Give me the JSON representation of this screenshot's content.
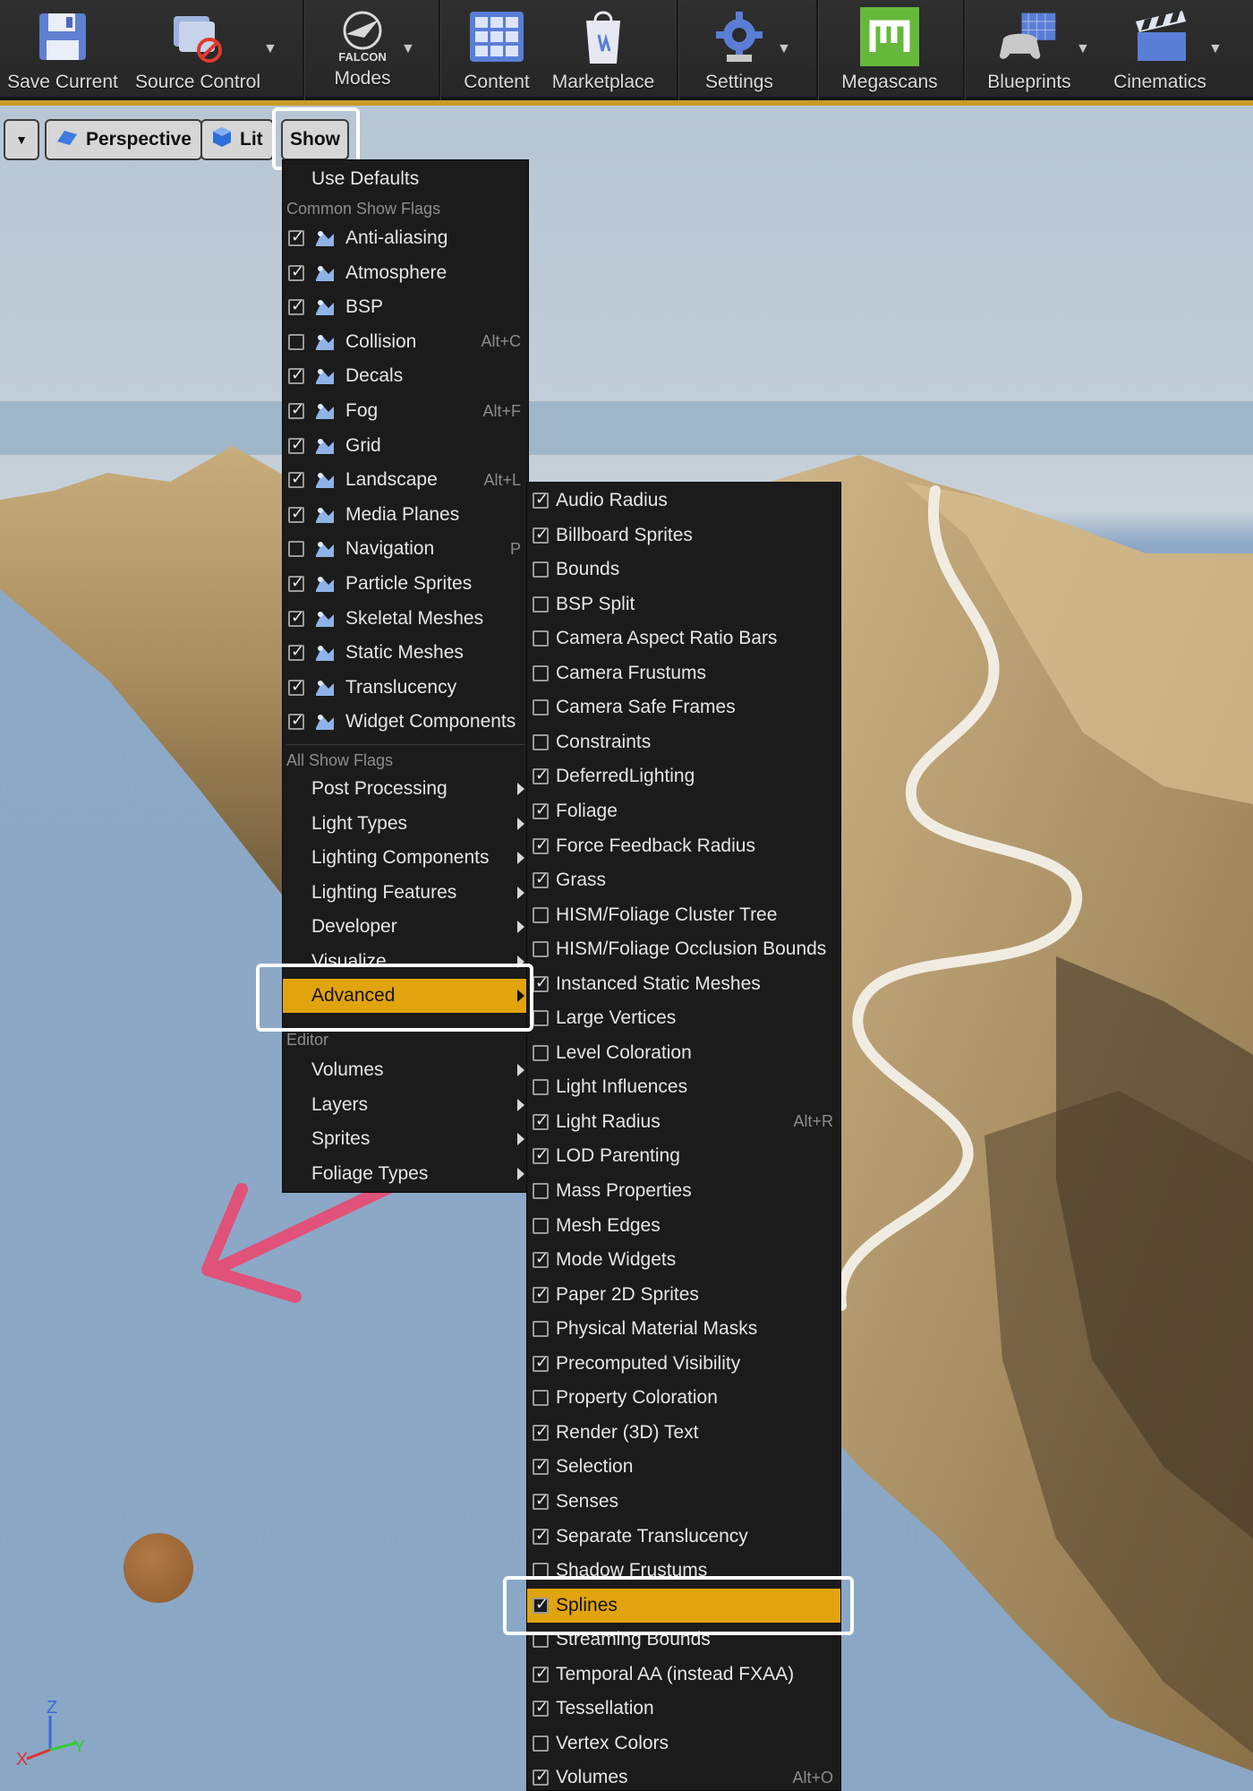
{
  "toolbar": {
    "save_current": "Save Current",
    "source_control": "Source Control",
    "modes_brand": "FALCON",
    "modes": "Modes",
    "content": "Content",
    "marketplace": "Marketplace",
    "settings": "Settings",
    "megascans": "Megascans",
    "blueprints": "Blueprints",
    "cinematics": "Cinematics"
  },
  "viewport": {
    "perspective": "Perspective",
    "lit": "Lit",
    "show": "Show"
  },
  "show_menu": {
    "use_defaults": "Use Defaults",
    "common_header": "Common Show Flags",
    "common": [
      {
        "label": "Anti-aliasing",
        "checked": true,
        "shortcut": ""
      },
      {
        "label": "Atmosphere",
        "checked": true,
        "shortcut": ""
      },
      {
        "label": "BSP",
        "checked": true,
        "shortcut": ""
      },
      {
        "label": "Collision",
        "checked": false,
        "shortcut": "Alt+C"
      },
      {
        "label": "Decals",
        "checked": true,
        "shortcut": ""
      },
      {
        "label": "Fog",
        "checked": true,
        "shortcut": "Alt+F"
      },
      {
        "label": "Grid",
        "checked": true,
        "shortcut": ""
      },
      {
        "label": "Landscape",
        "checked": true,
        "shortcut": "Alt+L"
      },
      {
        "label": "Media Planes",
        "checked": true,
        "shortcut": ""
      },
      {
        "label": "Navigation",
        "checked": false,
        "shortcut": "P"
      },
      {
        "label": "Particle Sprites",
        "checked": true,
        "shortcut": ""
      },
      {
        "label": "Skeletal Meshes",
        "checked": true,
        "shortcut": ""
      },
      {
        "label": "Static Meshes",
        "checked": true,
        "shortcut": ""
      },
      {
        "label": "Translucency",
        "checked": true,
        "shortcut": ""
      },
      {
        "label": "Widget Components",
        "checked": true,
        "shortcut": ""
      }
    ],
    "all_header": "All Show Flags",
    "all": [
      "Post Processing",
      "Light Types",
      "Lighting Components",
      "Lighting Features",
      "Developer",
      "Visualize",
      "Advanced"
    ],
    "editor_header": "Editor",
    "editor": [
      "Volumes",
      "Layers",
      "Sprites",
      "Foliage Types"
    ]
  },
  "advanced_menu": [
    {
      "label": "Audio Radius",
      "checked": true,
      "shortcut": ""
    },
    {
      "label": "Billboard Sprites",
      "checked": true,
      "shortcut": ""
    },
    {
      "label": "Bounds",
      "checked": false,
      "shortcut": ""
    },
    {
      "label": "BSP Split",
      "checked": false,
      "shortcut": ""
    },
    {
      "label": "Camera Aspect Ratio Bars",
      "checked": false,
      "shortcut": ""
    },
    {
      "label": "Camera Frustums",
      "checked": false,
      "shortcut": ""
    },
    {
      "label": "Camera Safe Frames",
      "checked": false,
      "shortcut": ""
    },
    {
      "label": "Constraints",
      "checked": false,
      "shortcut": ""
    },
    {
      "label": "DeferredLighting",
      "checked": true,
      "shortcut": ""
    },
    {
      "label": "Foliage",
      "checked": true,
      "shortcut": ""
    },
    {
      "label": "Force Feedback Radius",
      "checked": true,
      "shortcut": ""
    },
    {
      "label": "Grass",
      "checked": true,
      "shortcut": ""
    },
    {
      "label": "HISM/Foliage Cluster Tree",
      "checked": false,
      "shortcut": ""
    },
    {
      "label": "HISM/Foliage Occlusion Bounds",
      "checked": false,
      "shortcut": ""
    },
    {
      "label": "Instanced Static Meshes",
      "checked": true,
      "shortcut": ""
    },
    {
      "label": "Large Vertices",
      "checked": false,
      "shortcut": ""
    },
    {
      "label": "Level Coloration",
      "checked": false,
      "shortcut": ""
    },
    {
      "label": "Light Influences",
      "checked": false,
      "shortcut": ""
    },
    {
      "label": "Light Radius",
      "checked": true,
      "shortcut": "Alt+R"
    },
    {
      "label": "LOD Parenting",
      "checked": true,
      "shortcut": ""
    },
    {
      "label": "Mass Properties",
      "checked": false,
      "shortcut": ""
    },
    {
      "label": "Mesh Edges",
      "checked": false,
      "shortcut": ""
    },
    {
      "label": "Mode Widgets",
      "checked": true,
      "shortcut": ""
    },
    {
      "label": "Paper 2D Sprites",
      "checked": true,
      "shortcut": ""
    },
    {
      "label": "Physical Material Masks",
      "checked": false,
      "shortcut": ""
    },
    {
      "label": "Precomputed Visibility",
      "checked": true,
      "shortcut": ""
    },
    {
      "label": "Property Coloration",
      "checked": false,
      "shortcut": ""
    },
    {
      "label": "Render (3D) Text",
      "checked": true,
      "shortcut": ""
    },
    {
      "label": "Selection",
      "checked": true,
      "shortcut": ""
    },
    {
      "label": "Senses",
      "checked": true,
      "shortcut": ""
    },
    {
      "label": "Separate Translucency",
      "checked": true,
      "shortcut": ""
    },
    {
      "label": "Shadow Frustums",
      "checked": false,
      "shortcut": ""
    },
    {
      "label": "Splines",
      "checked": true,
      "shortcut": ""
    },
    {
      "label": "Streaming Bounds",
      "checked": false,
      "shortcut": ""
    },
    {
      "label": "Temporal AA (instead FXAA)",
      "checked": true,
      "shortcut": ""
    },
    {
      "label": "Tessellation",
      "checked": true,
      "shortcut": ""
    },
    {
      "label": "Vertex Colors",
      "checked": false,
      "shortcut": ""
    },
    {
      "label": "Volumes",
      "checked": true,
      "shortcut": "Alt+O"
    }
  ],
  "axis": {
    "x": "X",
    "y": "Y",
    "z": "Z"
  },
  "colors": {
    "highlight": "#e1a40f",
    "menu_bg": "#1b1b1b",
    "callout": "#ffffff",
    "arrow": "#e0527a",
    "terrain": "#b99a68"
  }
}
